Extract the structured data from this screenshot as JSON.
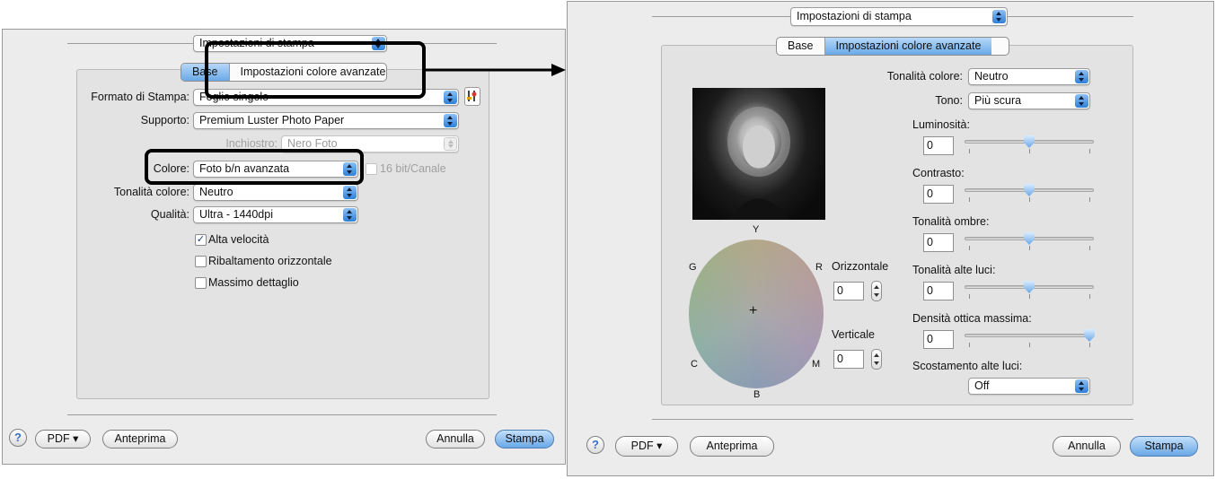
{
  "left_dialog": {
    "preset_popup": "Impostazioni di stampa",
    "tabs": [
      "Base",
      "Impostazioni colore avanzate"
    ],
    "rows": [
      {
        "label": "Formato di Stampa:",
        "value": "Foglio singolo"
      },
      {
        "label": "Supporto:",
        "value": "Premium Luster Photo Paper"
      },
      {
        "label": "Inchiostro:",
        "value": "Nero Foto"
      },
      {
        "label": "Colore:",
        "value": "Foto b/n avanzata"
      },
      {
        "label": "Tonalità colore:",
        "value": "Neutro"
      },
      {
        "label": "Qualità:",
        "value": "Ultra - 1440dpi"
      }
    ],
    "bit_checkbox": "16 bit/Canale",
    "checkboxes": [
      {
        "label": "Alta velocità",
        "checked": true
      },
      {
        "label": "Ribaltamento orizzontale",
        "checked": false
      },
      {
        "label": "Massimo dettaglio",
        "checked": false
      }
    ],
    "footer": {
      "help": "?",
      "pdf": "PDF ▾",
      "preview": "Anteprima",
      "cancel": "Annulla",
      "print": "Stampa"
    }
  },
  "right_dialog": {
    "preset_popup": "Impostazioni di stampa",
    "tabs": [
      "Base",
      "Impostazioni colore avanzate"
    ],
    "tone_color": {
      "label": "Tonalità colore:",
      "value": "Neutro"
    },
    "tone": {
      "label": "Tono:",
      "value": "Più scura"
    },
    "sliders": [
      {
        "label": "Luminosità:",
        "value": "0",
        "level": 0.5
      },
      {
        "label": "Contrasto:",
        "value": "0",
        "level": 0.5
      },
      {
        "label": "Tonalità ombre:",
        "value": "0",
        "level": 0.5
      },
      {
        "label": "Tonalità alte luci:",
        "value": "0",
        "level": 0.5
      },
      {
        "label": "Densità ottica massima:",
        "value": "0",
        "level": 1.0
      }
    ],
    "highlight_offset": {
      "label": "Scostamento alte luci:",
      "value": "Off"
    },
    "color_wheel": {
      "y": "Y",
      "g": "G",
      "r": "R",
      "c": "C",
      "m": "M",
      "b": "B",
      "center": "+"
    },
    "horizontal": {
      "label": "Orizzontale",
      "value": "0"
    },
    "vertical": {
      "label": "Verticale",
      "value": "0"
    },
    "footer": {
      "help": "?",
      "pdf": "PDF ▾",
      "preview": "Anteprima",
      "cancel": "Annulla",
      "print": "Stampa"
    }
  },
  "colors": {
    "accent": "#5b9ee6",
    "highlight_box": "#000000"
  }
}
